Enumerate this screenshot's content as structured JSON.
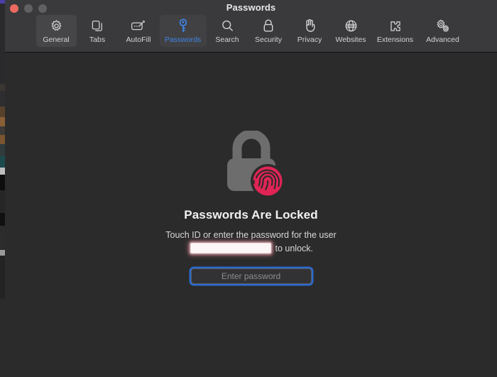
{
  "window": {
    "title": "Passwords",
    "traffic_lights": [
      {
        "name": "close",
        "color": "#ec6a5f",
        "label": "Close"
      },
      {
        "name": "minimize",
        "color": "#606062",
        "label": "Minimize"
      },
      {
        "name": "zoom",
        "color": "#606062",
        "label": "Zoom"
      }
    ]
  },
  "toolbar": {
    "items": [
      {
        "id": "general",
        "label": "General",
        "icon": "gear-icon",
        "state": "hover"
      },
      {
        "id": "tabs",
        "label": "Tabs",
        "icon": "tabs-icon",
        "state": "normal"
      },
      {
        "id": "autofill",
        "label": "AutoFill",
        "icon": "autofill-icon",
        "state": "normal"
      },
      {
        "id": "passwords",
        "label": "Passwords",
        "icon": "key-icon",
        "state": "selected"
      },
      {
        "id": "search",
        "label": "Search",
        "icon": "magnifier-icon",
        "state": "normal"
      },
      {
        "id": "security",
        "label": "Security",
        "icon": "padlock-icon",
        "state": "normal"
      },
      {
        "id": "privacy",
        "label": "Privacy",
        "icon": "hand-icon",
        "state": "normal"
      },
      {
        "id": "websites",
        "label": "Websites",
        "icon": "globe-icon",
        "state": "normal"
      },
      {
        "id": "extensions",
        "label": "Extensions",
        "icon": "puzzle-piece-icon",
        "state": "normal"
      },
      {
        "id": "advanced",
        "label": "Advanced",
        "icon": "gears-icon",
        "state": "normal"
      }
    ]
  },
  "locked_panel": {
    "graphic": "padlock-with-fingerprint-icon",
    "heading": "Passwords Are Locked",
    "subtext_before": "Touch ID or enter the password for the user",
    "username_redacted": "",
    "subtext_after": "to unlock.",
    "password_placeholder": "Enter password",
    "password_value": ""
  },
  "colors": {
    "window_background": "#2b2b2b",
    "titlebar_background": "#3a3a3c",
    "accent_blue": "#3f84e8",
    "focus_ring_blue": "#2a6ed6",
    "lock_gray": "#6d6d6d",
    "fingerprint_pink": "#e02455",
    "close_red": "#ec6a5f"
  }
}
